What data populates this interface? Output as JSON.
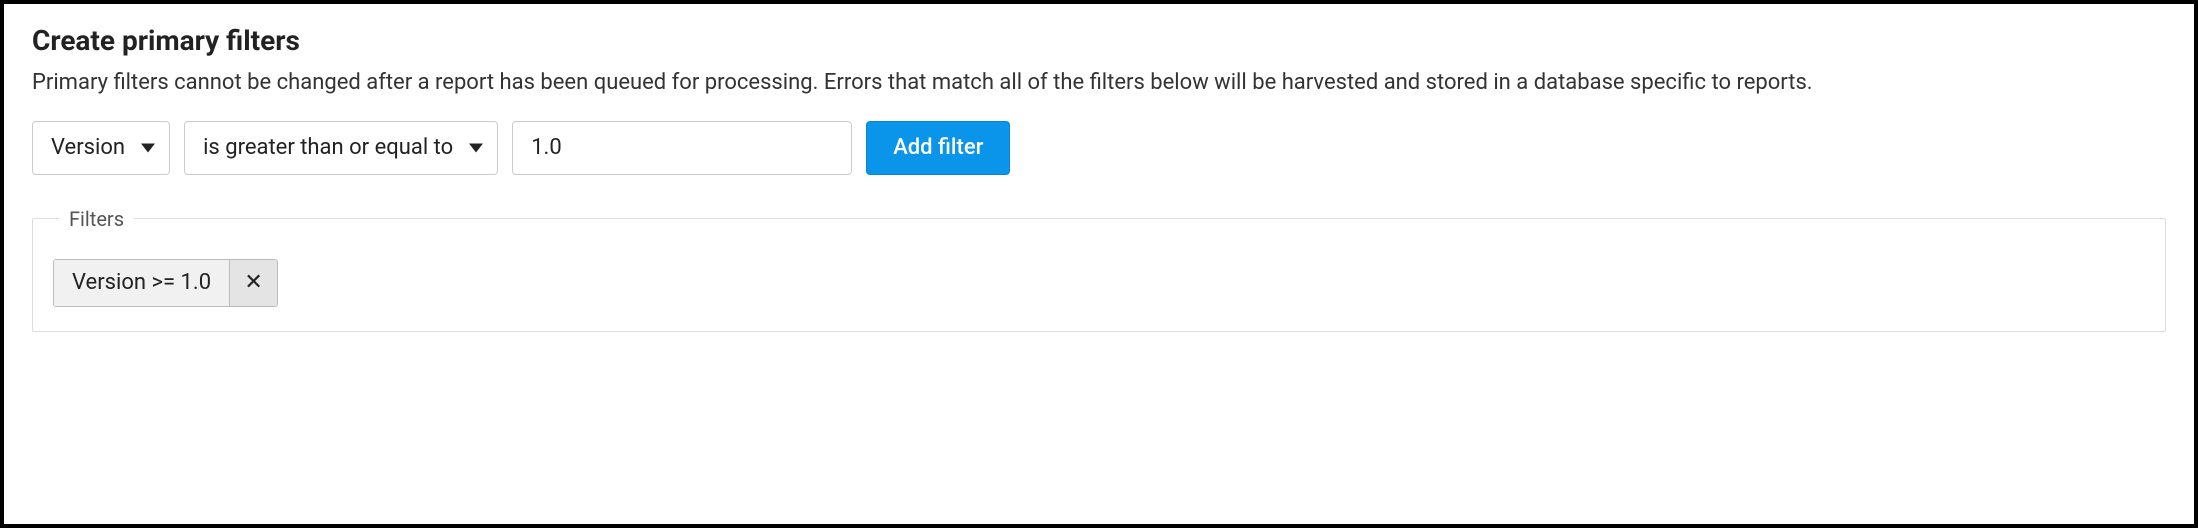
{
  "heading": "Create primary filters",
  "description": "Primary filters cannot be changed after a report has been queued for processing. Errors that match all of the filters below will be harvested and stored in a database specific to reports.",
  "filterBuilder": {
    "fieldSelect": "Version",
    "operatorSelect": "is greater than or equal to",
    "valueInput": "1.0",
    "addButtonLabel": "Add filter"
  },
  "filtersBox": {
    "legend": "Filters",
    "chips": [
      {
        "label": "Version >= 1.0",
        "closeGlyph": "✕"
      }
    ]
  }
}
